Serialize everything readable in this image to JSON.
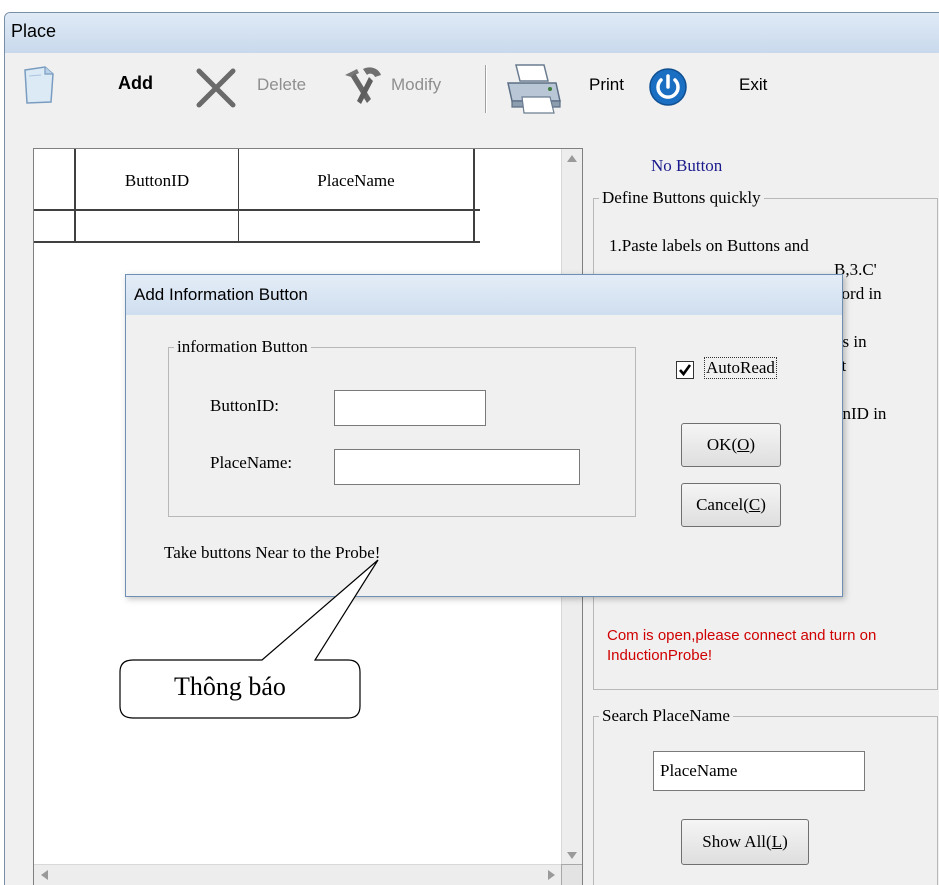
{
  "window": {
    "title": "Place"
  },
  "toolbar": {
    "add_label": "Add",
    "delete_label": "Delete",
    "modify_label": "Modify",
    "print_label": "Print",
    "exit_label": "Exit"
  },
  "grid": {
    "columns": [
      "ButtonID",
      "PlaceName"
    ]
  },
  "side": {
    "status_label": "No Button",
    "define_group_label": "Define Buttons quickly",
    "define_lines": [
      "1.Paste labels on Buttons and",
      "B,3.C'",
      "cord in",
      "ns in",
      "ct",
      ",",
      "onID in"
    ],
    "com_message": "Com is open,please connect and turn on InductionProbe!",
    "search_group_label": "Search PlaceName",
    "search_value": "PlaceName",
    "show_all_label": "Show All(",
    "show_all_hotkey": "L",
    "show_all_tail": ")"
  },
  "dialog": {
    "title": "Add Information Button",
    "group_label": "information Button",
    "buttonid_label": "ButtonID:",
    "placename_label": "PlaceName:",
    "buttonid_value": "",
    "placename_value": "",
    "autoread_label": "AutoRead",
    "autoread_checked": true,
    "ok_label": "OK(",
    "ok_hotkey": "O",
    "ok_tail": ")",
    "cancel_label": "Cancel(",
    "cancel_hotkey": "C",
    "cancel_tail": ")",
    "hint": "Take buttons Near to the Probe!"
  },
  "callout": {
    "text": "Thông báo"
  },
  "colors": {
    "accent": "#1b6fc2",
    "error": "#d00000",
    "status": "#1a1a8c"
  }
}
